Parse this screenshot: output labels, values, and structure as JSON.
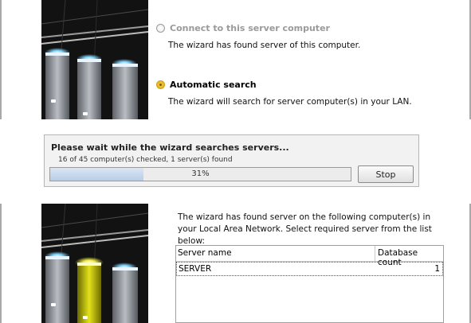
{
  "connect_panel": {
    "option_this_computer": {
      "title": "Connect to this server computer",
      "description": "The wizard has found server of this computer."
    },
    "option_automatic": {
      "title": "Automatic search",
      "description": "The wizard will search for server computer(s) in your LAN."
    }
  },
  "progress_dialog": {
    "title": "Please wait while the wizard searches servers...",
    "status": "16 of 45 computer(s) checked,  1 server(s) found",
    "progress_fraction": 0.31,
    "progress_label": "31%",
    "stop_label": "Stop"
  },
  "results_panel": {
    "description": "The wizard has found server on the following computer(s) in your Local Area Network. Select required server from the list below:",
    "columns": [
      "Server name",
      "Database count"
    ],
    "rows": [
      {
        "server_name": "SERVER",
        "database_count": "1"
      }
    ]
  },
  "colors": {
    "server_highlight": "#d6d400",
    "radio_checked": "#e7b417",
    "progress_fill": "#c6d7ec"
  }
}
